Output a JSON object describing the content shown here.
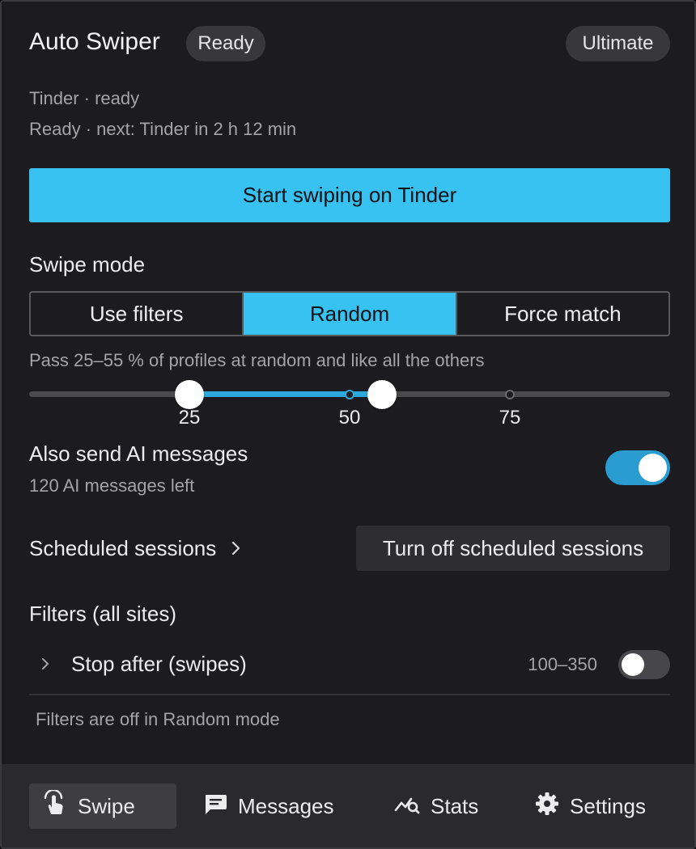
{
  "header": {
    "title": "Auto Swiper",
    "status_pill": "Ready",
    "tier_pill": "Ultimate"
  },
  "status": {
    "site_status": "Tinder · ready",
    "next_run": "Ready · next: Tinder in 2 h 12 min"
  },
  "start_button": "Start swiping on Tinder",
  "swipe_mode": {
    "label": "Swipe mode",
    "options": [
      "Use filters",
      "Random",
      "Force match"
    ],
    "selected": "Random",
    "description": "Pass 25–55 % of profiles at random and like all the others"
  },
  "pass_slider": {
    "min": 0,
    "max": 100,
    "low": 25,
    "high": 55,
    "ticks": [
      "25",
      "50",
      "75"
    ]
  },
  "ai_messages": {
    "label": "Also send AI messages",
    "remaining": "120 AI messages left",
    "enabled": true
  },
  "scheduled": {
    "label": "Scheduled sessions",
    "button": "Turn off scheduled sessions"
  },
  "filters": {
    "label": "Filters (all sites)",
    "stop_after": {
      "label": "Stop after (swipes)",
      "range": "100–350",
      "enabled": false
    },
    "note": "Filters are off in Random mode"
  },
  "nav": {
    "items": [
      "Swipe",
      "Messages",
      "Stats",
      "Settings"
    ],
    "icons": [
      "touch-icon",
      "chat-icon",
      "stats-icon",
      "gear-icon"
    ],
    "active": "Swipe"
  },
  "colors": {
    "accent": "#38c2f2",
    "toggle_on": "#2a9cd0",
    "panel_bg": "#1c1c20",
    "nav_bg": "#2a2a2e"
  }
}
